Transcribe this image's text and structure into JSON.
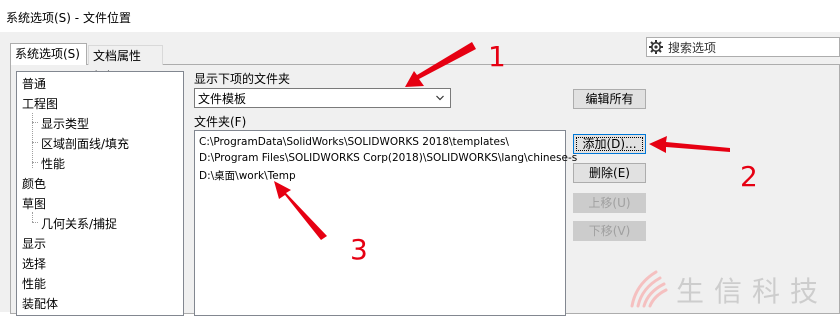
{
  "window": {
    "title": "系统选项(S) - 文件位置"
  },
  "tabs": [
    {
      "label": "系统选项(S)",
      "active": true
    },
    {
      "label": "文档属性(D)",
      "active": false
    }
  ],
  "search": {
    "placeholder": "搜索选项",
    "icon": "gear-search-icon"
  },
  "tree": {
    "items": [
      {
        "label": "普通",
        "level": 0
      },
      {
        "label": "工程图",
        "level": 0
      },
      {
        "label": "显示类型",
        "level": 1
      },
      {
        "label": "区域剖面线/填充",
        "level": 1
      },
      {
        "label": "性能",
        "level": 1
      },
      {
        "label": "颜色",
        "level": 0
      },
      {
        "label": "草图",
        "level": 0
      },
      {
        "label": "几何关系/捕捉",
        "level": 1
      },
      {
        "label": "显示",
        "level": 0
      },
      {
        "label": "选择",
        "level": 0
      },
      {
        "label": "性能",
        "level": 0
      },
      {
        "label": "装配体",
        "level": 0
      }
    ]
  },
  "folder_type": {
    "label": "显示下项的文件夹",
    "value": "文件模板"
  },
  "folders": {
    "label": "文件夹(F)",
    "items": [
      "C:\\ProgramData\\SolidWorks\\SOLIDWORKS 2018\\templates\\",
      "D:\\Program Files\\SOLIDWORKS Corp(2018)\\SOLIDWORKS\\lang\\chinese-s",
      "D:\\桌面\\work\\Temp"
    ]
  },
  "buttons": {
    "edit_all": "编辑所有",
    "add": "添加(D)...",
    "delete": "删除(E)",
    "move_up": "上移(U)",
    "move_down": "下移(V)"
  },
  "annotations": {
    "n1": "1",
    "n2": "2",
    "n3": "3",
    "color": "#e60012"
  },
  "watermark": {
    "text": "生信科技"
  }
}
